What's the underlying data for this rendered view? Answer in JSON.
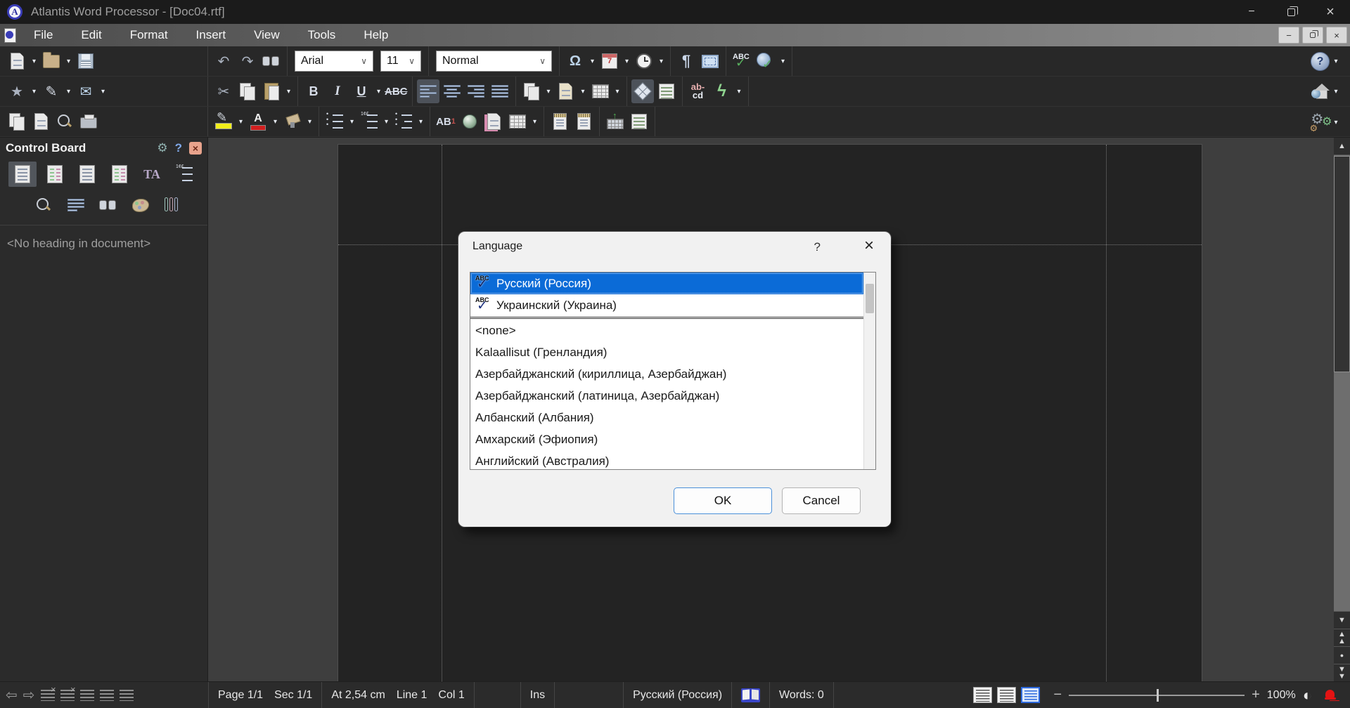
{
  "window": {
    "title": "Atlantis Word Processor - [Doc04.rtf]"
  },
  "menu": {
    "items": [
      "File",
      "Edit",
      "Format",
      "Insert",
      "View",
      "Tools",
      "Help"
    ]
  },
  "toolbar": {
    "font_name": "Arial",
    "font_size": "11",
    "style_name": "Normal",
    "bold": "B",
    "italic": "I",
    "underline": "U",
    "strikethrough": "ABC",
    "spell_abc": "ABC",
    "omega": "Ω",
    "pilcrow": "¶",
    "calendar_day": "7",
    "hyphen_top": "ab-",
    "hyphen_bottom": "cd",
    "footnote_ab": "AB",
    "footnote_sup": "1",
    "fontcolor_letter": "A"
  },
  "icons": {
    "dropdown": "▾",
    "combo_chevron": "∨",
    "undo": "↶",
    "redo": "↷",
    "star": "★",
    "edit": "✎",
    "mail": "✉",
    "cut": "✂",
    "check": "✓",
    "lightning": "ϟ",
    "gear": "⚙",
    "help": "?",
    "close_x": "×",
    "minimize": "−",
    "nav_left": "⇦",
    "nav_right": "⇨",
    "scroll_up": "▲",
    "scroll_down": "▼",
    "browse_circle": "●",
    "half_circle": "◐",
    "zoom_minus": "−",
    "zoom_plus": "+",
    "app_letter": "A"
  },
  "control_board": {
    "title": "Control Board",
    "help": "?",
    "close": "×",
    "fonts_glyph": "TA",
    "no_heading": "<No heading in document>"
  },
  "dialog": {
    "title": "Language",
    "help": "?",
    "close": "×",
    "spell_icon_text": "ABC",
    "separator_after_index": 1,
    "items": [
      {
        "label": "Русский (Россия)",
        "spell": true,
        "selected": true
      },
      {
        "label": "Украинский (Украина)",
        "spell": true,
        "selected": false
      },
      {
        "label": "<none>",
        "spell": false,
        "selected": false
      },
      {
        "label": "Kalaallisut (Гренландия)",
        "spell": false,
        "selected": false
      },
      {
        "label": "Азербайджанский (кириллица, Азербайджан)",
        "spell": false,
        "selected": false
      },
      {
        "label": "Азербайджанский (латиница, Азербайджан)",
        "spell": false,
        "selected": false
      },
      {
        "label": "Албанский (Албания)",
        "spell": false,
        "selected": false
      },
      {
        "label": "Амхарский (Эфиопия)",
        "spell": false,
        "selected": false
      },
      {
        "label": "Английский (Австралия)",
        "spell": false,
        "selected": false
      }
    ],
    "ok": "OK",
    "cancel": "Cancel"
  },
  "status": {
    "page": "Page 1/1",
    "section": "Sec 1/1",
    "position": "At 2,54 cm",
    "line": "Line 1",
    "column": "Col 1",
    "insert_mode": "Ins",
    "language": "Русский (Россия)",
    "words": "Words: 0",
    "zoom": "100%"
  },
  "colors": {
    "selection_blue": "#0b6bd7",
    "ok_button_border": "#4a90d9",
    "active_view_blue": "#2f6bdf",
    "bell_red": "#e31313",
    "titlebar_bg": "#1b1b1b",
    "toolbar_bg": "#282828",
    "document_area_bg": "#3e3e3e",
    "page_bg": "#232323",
    "dialog_bg": "#f1f1f1",
    "status_text": "#e8e8e8"
  }
}
